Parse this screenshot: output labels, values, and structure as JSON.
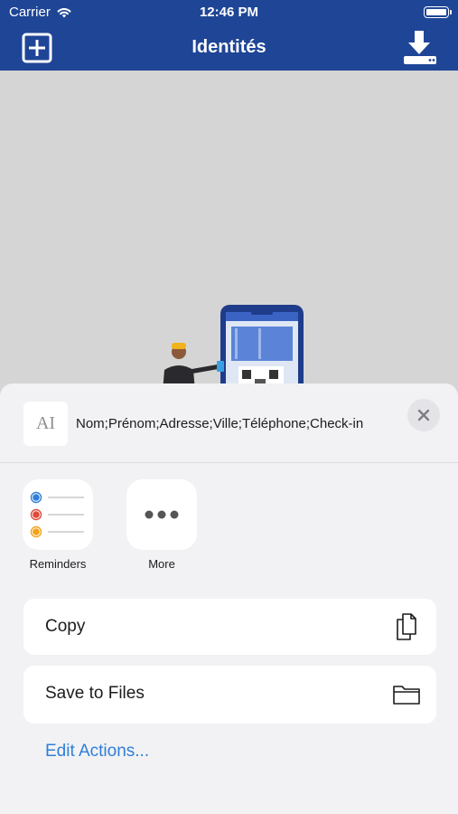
{
  "status_bar": {
    "carrier": "Carrier",
    "time": "12:46 PM"
  },
  "nav_bar": {
    "title": "Identités",
    "add_icon": "plus-square-icon",
    "download_icon": "download-icon"
  },
  "share_sheet": {
    "document_title": "Nom;Prénom;Adresse;Ville;Téléphone;Check-in",
    "document_icon_text": "AI",
    "apps": [
      {
        "label": "Reminders",
        "icon": "reminders-icon"
      },
      {
        "label": "More",
        "icon": "more-icon"
      }
    ],
    "actions": [
      {
        "label": "Copy",
        "icon": "copy-icon"
      },
      {
        "label": "Save to Files",
        "icon": "folder-icon"
      }
    ],
    "edit_actions": "Edit Actions..."
  },
  "colors": {
    "nav_background": "#1f4596",
    "link": "#2f7fd8",
    "sheet_background": "#f2f2f4"
  }
}
